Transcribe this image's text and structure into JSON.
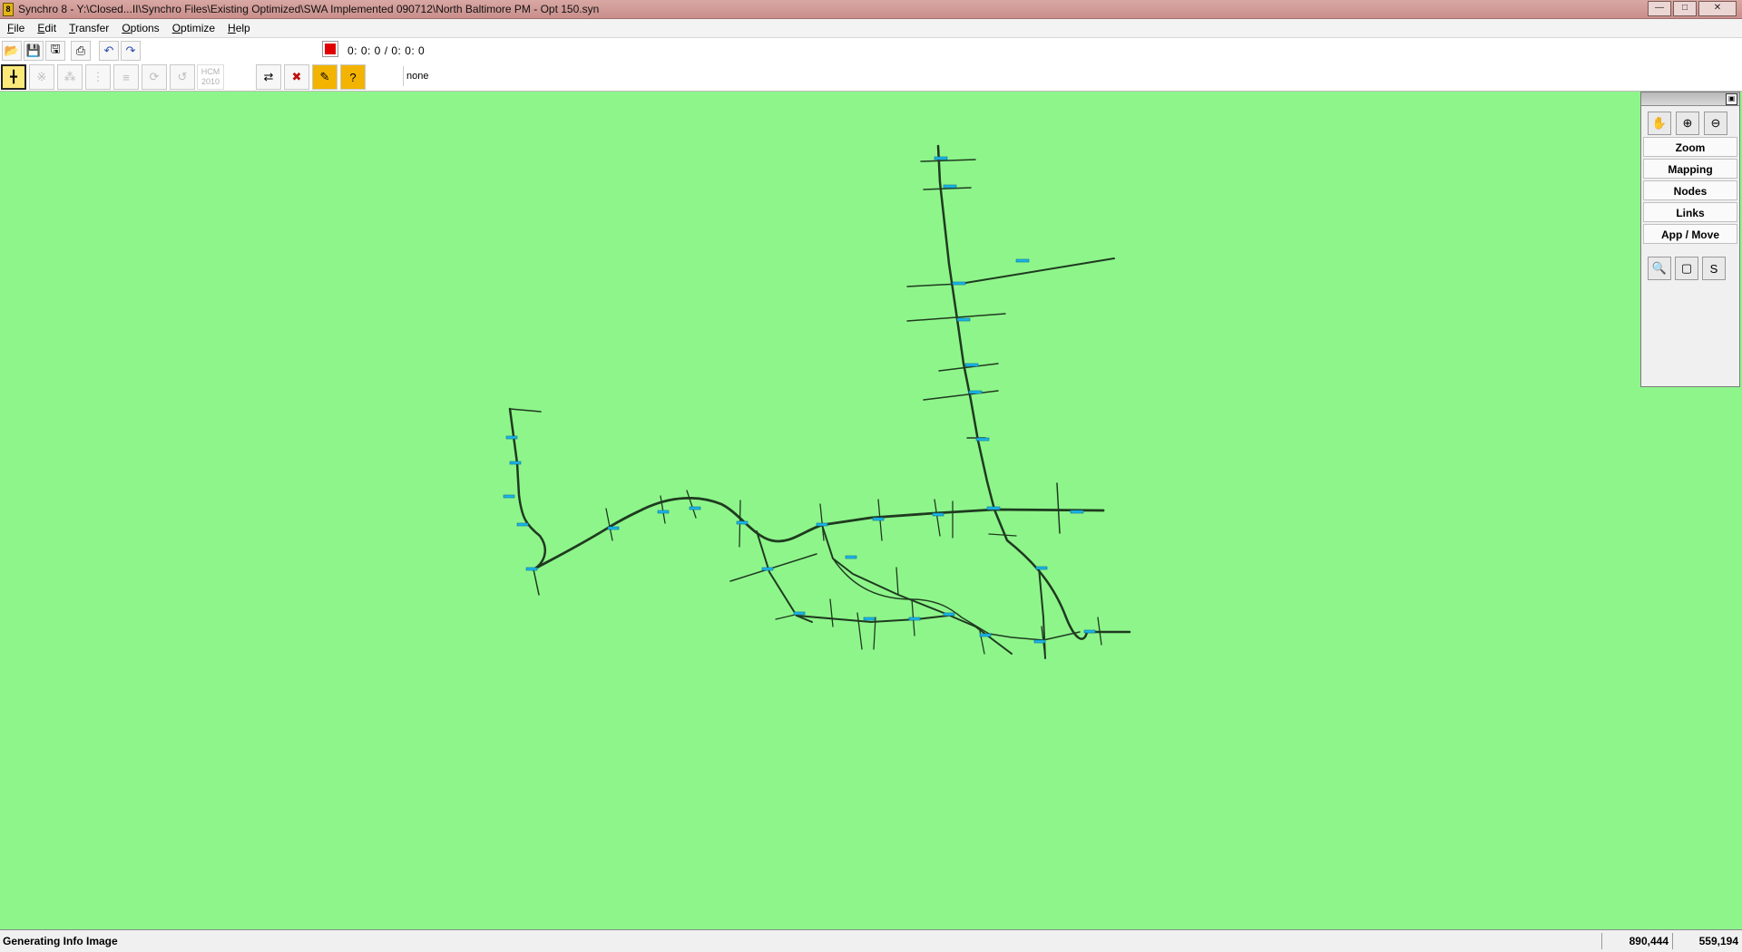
{
  "window": {
    "title": "Synchro 8 - Y:\\Closed...II\\Synchro Files\\Existing Optimized\\SWA Implemented 090712\\North Baltimore PM - Opt 150.syn",
    "app_icon": "8",
    "controls": [
      "minimize-icon",
      "maximize-icon",
      "close-icon"
    ]
  },
  "menu": [
    "File",
    "Edit",
    "Transfer",
    "Options",
    "Optimize",
    "Help"
  ],
  "toolbar": {
    "time_display": "0: 0: 0 /   0: 0: 0",
    "scenario_value": "none",
    "hcm_label_line1": "HCM",
    "hcm_label_line2": "2010",
    "icons": [
      "open-icon",
      "save-icon",
      "save-as-icon",
      "print-icon",
      "undo-icon",
      "redo-icon",
      "stop-icon"
    ]
  },
  "palette": {
    "buttons": [
      "Zoom",
      "Mapping",
      "Nodes",
      "Links",
      "App / Move"
    ],
    "tools": [
      "pan-hand-icon",
      "zoom-in-icon",
      "zoom-out-icon"
    ],
    "zoom_tools": [
      "zoom-all-icon",
      "zoom-window-icon",
      "zoom-scale-icon"
    ]
  },
  "statusbar": {
    "message": "Generating Info Image",
    "coord_x": "890,444",
    "coord_y": "559,194"
  },
  "colors": {
    "map_background": "#8ef58b",
    "road": "#1f3a1f",
    "marker": "#1ab7e8",
    "title_bar": "#c98f8c"
  }
}
